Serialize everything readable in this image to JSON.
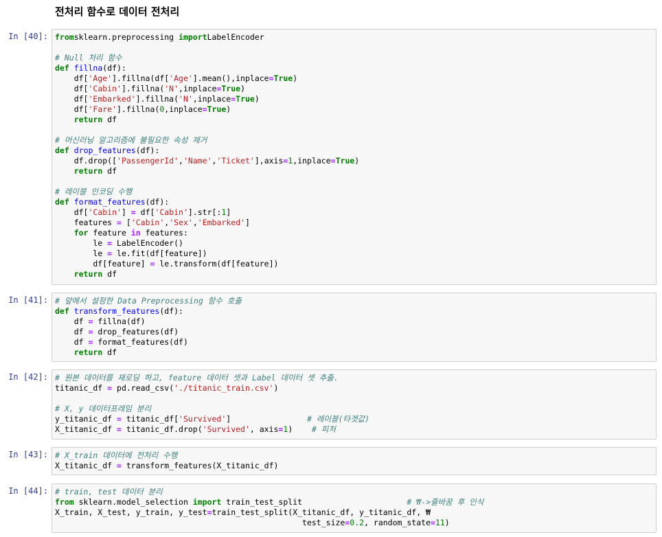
{
  "heading": "전처리 함수로 데이터 전처리",
  "cells": [
    {
      "prompt": "In [40]:",
      "lines": [
        [
          [
            "k",
            "from"
          ],
          [
            "",
            "sklearn.preprocessing "
          ],
          [
            "k",
            "import"
          ],
          [
            "",
            "LabelEncoder"
          ]
        ],
        [],
        [
          [
            "c",
            "# Null 처리 함수"
          ]
        ],
        [
          [
            "k",
            "def"
          ],
          [
            "",
            " "
          ],
          [
            "f",
            "fillna"
          ],
          [
            "",
            "(df):"
          ]
        ],
        [
          [
            "",
            "    df["
          ],
          [
            "s",
            "'Age'"
          ],
          [
            "",
            "].fillna(df["
          ],
          [
            "s",
            "'Age'"
          ],
          [
            "",
            "].mean(),inplace"
          ],
          [
            "o",
            "="
          ],
          [
            "k",
            "True"
          ],
          [
            "",
            ")"
          ]
        ],
        [
          [
            "",
            "    df["
          ],
          [
            "s",
            "'Cabin'"
          ],
          [
            "",
            "].fillna("
          ],
          [
            "s",
            "'N'"
          ],
          [
            "",
            ",inplace"
          ],
          [
            "o",
            "="
          ],
          [
            "k",
            "True"
          ],
          [
            "",
            ")"
          ]
        ],
        [
          [
            "",
            "    df["
          ],
          [
            "s",
            "'Embarked'"
          ],
          [
            "",
            "].fillna("
          ],
          [
            "s",
            "'N'"
          ],
          [
            "",
            ",inplace"
          ],
          [
            "o",
            "="
          ],
          [
            "k",
            "True"
          ],
          [
            "",
            ")"
          ]
        ],
        [
          [
            "",
            "    df["
          ],
          [
            "s",
            "'Fare'"
          ],
          [
            "",
            "].fillna("
          ],
          [
            "m",
            "0"
          ],
          [
            "",
            ",inplace"
          ],
          [
            "o",
            "="
          ],
          [
            "k",
            "True"
          ],
          [
            "",
            ")"
          ]
        ],
        [
          [
            "",
            "    "
          ],
          [
            "k",
            "return"
          ],
          [
            "",
            " df"
          ]
        ],
        [],
        [
          [
            "c",
            "# 머신러닝 알고리즘에 불필요한 속성 제거"
          ]
        ],
        [
          [
            "k",
            "def"
          ],
          [
            "",
            " "
          ],
          [
            "f",
            "drop_features"
          ],
          [
            "",
            "(df):"
          ]
        ],
        [
          [
            "",
            "    df.drop(["
          ],
          [
            "s",
            "'PassengerId'"
          ],
          [
            "",
            ","
          ],
          [
            "s",
            "'Name'"
          ],
          [
            "",
            ","
          ],
          [
            "s",
            "'Ticket'"
          ],
          [
            "",
            "],axis"
          ],
          [
            "o",
            "="
          ],
          [
            "m",
            "1"
          ],
          [
            "",
            ",inplace"
          ],
          [
            "o",
            "="
          ],
          [
            "k",
            "True"
          ],
          [
            "",
            ")"
          ]
        ],
        [
          [
            "",
            "    "
          ],
          [
            "k",
            "return"
          ],
          [
            "",
            " df"
          ]
        ],
        [],
        [
          [
            "c",
            "# 레이블 인코딩 수행"
          ]
        ],
        [
          [
            "k",
            "def"
          ],
          [
            "",
            " "
          ],
          [
            "f",
            "format_features"
          ],
          [
            "",
            "(df):"
          ]
        ],
        [
          [
            "",
            "    df["
          ],
          [
            "s",
            "'Cabin'"
          ],
          [
            "",
            "] "
          ],
          [
            "o",
            "="
          ],
          [
            "",
            " df["
          ],
          [
            "s",
            "'Cabin'"
          ],
          [
            "",
            "].str[:"
          ],
          [
            "m",
            "1"
          ],
          [
            "",
            "]"
          ]
        ],
        [
          [
            "",
            "    features "
          ],
          [
            "o",
            "="
          ],
          [
            "",
            " ["
          ],
          [
            "s",
            "'Cabin'"
          ],
          [
            "",
            ","
          ],
          [
            "s",
            "'Sex'"
          ],
          [
            "",
            ","
          ],
          [
            "s",
            "'Embarked'"
          ],
          [
            "",
            "]"
          ]
        ],
        [
          [
            "",
            "    "
          ],
          [
            "k",
            "for"
          ],
          [
            "",
            " feature "
          ],
          [
            "o",
            "in"
          ],
          [
            "",
            " features:"
          ]
        ],
        [
          [
            "",
            "        le "
          ],
          [
            "o",
            "="
          ],
          [
            "",
            " LabelEncoder()"
          ]
        ],
        [
          [
            "",
            "        le "
          ],
          [
            "o",
            "="
          ],
          [
            "",
            " le.fit(df[feature])"
          ]
        ],
        [
          [
            "",
            "        df[feature] "
          ],
          [
            "o",
            "="
          ],
          [
            "",
            " le.transform(df[feature])"
          ]
        ],
        [
          [
            "",
            "    "
          ],
          [
            "k",
            "return"
          ],
          [
            "",
            " df"
          ]
        ]
      ]
    },
    {
      "prompt": "In [41]:",
      "lines": [
        [
          [
            "c",
            "# 앞에서 설정한 Data Preprocessing 함수 호출"
          ]
        ],
        [
          [
            "k",
            "def"
          ],
          [
            "",
            " "
          ],
          [
            "f",
            "transform_features"
          ],
          [
            "",
            "(df):"
          ]
        ],
        [
          [
            "",
            "    df "
          ],
          [
            "o",
            "="
          ],
          [
            "",
            " fillna(df)"
          ]
        ],
        [
          [
            "",
            "    df "
          ],
          [
            "o",
            "="
          ],
          [
            "",
            " drop_features(df)"
          ]
        ],
        [
          [
            "",
            "    df "
          ],
          [
            "o",
            "="
          ],
          [
            "",
            " format_features(df)"
          ]
        ],
        [
          [
            "",
            "    "
          ],
          [
            "k",
            "return"
          ],
          [
            "",
            " df"
          ]
        ]
      ]
    },
    {
      "prompt": "In [42]:",
      "lines": [
        [
          [
            "c",
            "# 원본 데이터를 재로딩 하고, feature 데이터 셋과 Label 데이터 셋 추출."
          ]
        ],
        [
          [
            "",
            "titanic_df "
          ],
          [
            "o",
            "="
          ],
          [
            "",
            " pd.read_csv("
          ],
          [
            "s",
            "'./titanic_train.csv'"
          ],
          [
            "",
            ")"
          ]
        ],
        [],
        [
          [
            "c",
            "# X, y 데이터프레임 분리"
          ]
        ],
        [
          [
            "",
            "y_titanic_df "
          ],
          [
            "o",
            "="
          ],
          [
            "",
            " titanic_df["
          ],
          [
            "s",
            "'Survived'"
          ],
          [
            "",
            "]                "
          ],
          [
            "c",
            "# 레이블(타겟값)"
          ]
        ],
        [
          [
            "",
            "X_titanic_df "
          ],
          [
            "o",
            "="
          ],
          [
            "",
            " titanic_df.drop("
          ],
          [
            "s",
            "'Survived'"
          ],
          [
            "",
            ", axis"
          ],
          [
            "o",
            "="
          ],
          [
            "m",
            "1"
          ],
          [
            "",
            ")    "
          ],
          [
            "c",
            "# 피처"
          ]
        ]
      ]
    },
    {
      "prompt": "In [43]:",
      "lines": [
        [
          [
            "c",
            "# X_train 데이터에 전처리 수행"
          ]
        ],
        [
          [
            "",
            "X_titanic_df "
          ],
          [
            "o",
            "="
          ],
          [
            "",
            " transform_features(X_titanic_df)"
          ]
        ]
      ]
    },
    {
      "prompt": "In [44]:",
      "lines": [
        [
          [
            "c",
            "# train, test 데이터 분리"
          ]
        ],
        [
          [
            "k",
            "from"
          ],
          [
            "",
            " sklearn.model_selection "
          ],
          [
            "k",
            "import"
          ],
          [
            "",
            " train_test_split                      "
          ],
          [
            "c",
            "# ₩->줄바꿈 후 인식"
          ]
        ],
        [
          [
            "",
            "X_train, X_test, y_train, y_test"
          ],
          [
            "o",
            "="
          ],
          [
            "",
            "train_test_split(X_titanic_df, y_titanic_df, ₩"
          ]
        ],
        [
          [
            "",
            "                                                    test_size"
          ],
          [
            "o",
            "="
          ],
          [
            "m",
            "0.2"
          ],
          [
            "",
            ", random_state"
          ],
          [
            "o",
            "="
          ],
          [
            "m",
            "11"
          ],
          [
            "",
            ")"
          ]
        ]
      ]
    }
  ]
}
